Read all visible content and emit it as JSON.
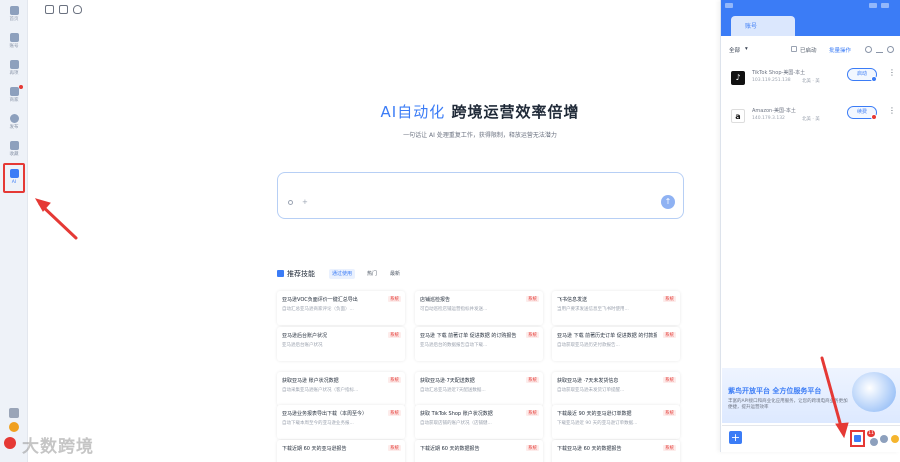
{
  "leftnav": {
    "items": [
      {
        "label": "首页"
      },
      {
        "label": "账号"
      },
      {
        "label": "再项"
      },
      {
        "label": "商家"
      },
      {
        "label": "发布"
      },
      {
        "label": "收藏"
      },
      {
        "label": "AI"
      }
    ]
  },
  "hero": {
    "title_accent": "AI自动化",
    "title_rest": "跨境运营效率倍增",
    "subtitle": "一句话让 AI 处理重复工作，获得限制，释放运营无法潜力"
  },
  "prompt": {
    "placeholder_icon": "clip-icon",
    "send_icon": "arrow-up-icon"
  },
  "skills": {
    "title": "推荐技能",
    "tabs": [
      "通过使用",
      "热门",
      "最新"
    ],
    "cards": [
      {
        "title": "亚马逊VOC负面评价一键汇总导出",
        "desc": "自动汇总亚马逊商家评论（负面）...",
        "badge": "系统"
      },
      {
        "title": "店铺巡检报告",
        "desc": "可自动巡检店铺运营指标并发送...",
        "badge": "系统"
      },
      {
        "title": "飞书信息发送",
        "desc": "当用户要求发送信息至飞书时使用...",
        "badge": "系统"
      },
      {
        "title": "亚马逊后台账户状况",
        "desc": "亚马逊后台账户状况",
        "badge": "系统"
      },
      {
        "title": "亚马逊 下载 前著订单 促进数据 的订购报告",
        "desc": "亚马逊后台的数据报告自动下载...",
        "badge": "系统"
      },
      {
        "title": "亚马逊 下载 前著历史订单 促进数据 的付款报告",
        "desc": "自动获取亚马逊历史付款报告...",
        "badge": "系统"
      },
      {
        "title": "获取亚马逊 账户状况数据",
        "desc": "自动采集亚马逊账户状况（客户指标...",
        "badge": "系统"
      },
      {
        "title": "获取亚马逊·7天配送数据",
        "desc": "自动汇总亚马逊近7天配送数据...",
        "badge": "系统"
      },
      {
        "title": "获取亚马逊 ·7天未发货信息",
        "desc": "自动获取亚马逊未发货订单提醒...",
        "badge": "系统"
      },
      {
        "title": "亚马逊业务报表导出下载（本周至今）",
        "desc": "自动下载本周至今的亚马逊业务报...",
        "badge": "系统"
      },
      {
        "title": "获取 TikTok Shop 账户状况数据",
        "desc": "自动获取店铺的账户状况（店铺健...",
        "badge": "系统"
      },
      {
        "title": "下载最近 90 天的亚马逊订单数据",
        "desc": "下载亚马逊近 90 天的亚马逊订单数据...",
        "badge": "系统"
      },
      {
        "title": "下载近期 60 天的亚马逊报告",
        "desc": "",
        "badge": "系统"
      },
      {
        "title": "下载近期 60 天的数据报告",
        "desc": "",
        "badge": "系统"
      },
      {
        "title": "下载亚马逊 60 天的数据报告",
        "desc": "",
        "badge": "系统"
      }
    ]
  },
  "panel": {
    "tab_label": "账号",
    "filter": "全部",
    "check_label": "已启动",
    "batch_label": "批量操作",
    "accounts": [
      {
        "logo": "♪",
        "name": "TikTok Shop-美国-本土",
        "ip": "103.119.251.138",
        "loc": "北美 · 美",
        "button": "启动"
      },
      {
        "logo": "a",
        "name": "Amazon-美国-本土",
        "ip": "140.179.3.132",
        "loc": "北美 · 美",
        "button": "续费"
      }
    ],
    "banner_title": "紫鸟开放平台 全方位服务平台",
    "banner_sub": "丰富的API接口和商业化应用服务，让您的跨境电商业务更加便捷，提升运营效率",
    "footer_badge": "11"
  },
  "watermark": "大数跨境"
}
